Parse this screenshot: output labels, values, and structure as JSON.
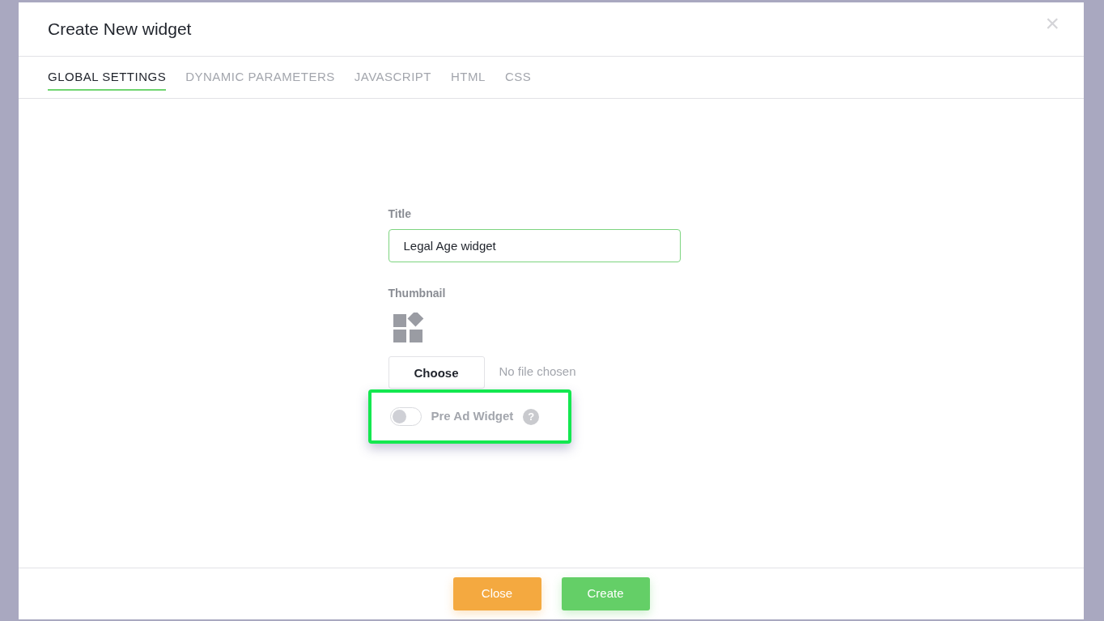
{
  "dialog": {
    "title": "Create New widget",
    "close_icon": "×"
  },
  "tabs": [
    {
      "label": "GLOBAL SETTINGS",
      "selected": true
    },
    {
      "label": "DYNAMIC PARAMETERS",
      "selected": false
    },
    {
      "label": "JAVASCRIPT",
      "selected": false
    },
    {
      "label": "HTML",
      "selected": false
    },
    {
      "label": "CSS",
      "selected": false
    }
  ],
  "form": {
    "title_label": "Title",
    "title_value": "Legal Age widget",
    "thumbnail_label": "Thumbnail",
    "choose_button": "Choose",
    "file_status": "No file chosen",
    "pre_ad_toggle": {
      "label": "Pre Ad Widget",
      "on": false,
      "help": "?",
      "highlighted": true
    }
  },
  "footer": {
    "buttons": [
      {
        "label": "Close",
        "kind": "secondary"
      },
      {
        "label": "Create",
        "kind": "primary"
      }
    ]
  }
}
